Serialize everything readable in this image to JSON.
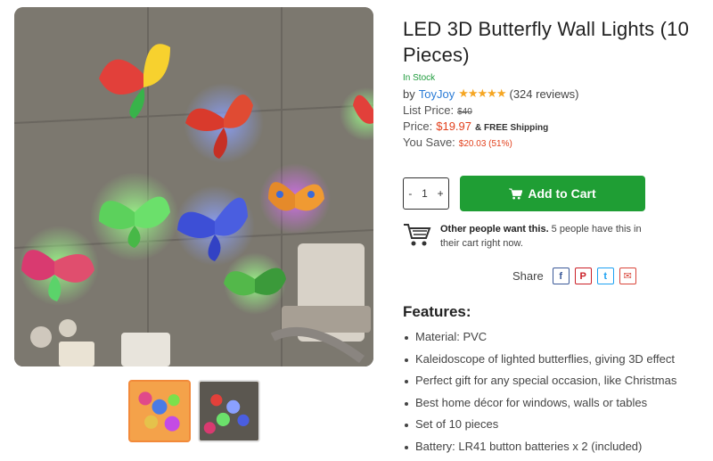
{
  "product": {
    "title": "LED 3D Butterfly Wall Lights (10 Pieces)",
    "stock": "In Stock",
    "by_label": "by",
    "brand": "ToyJoy",
    "rating": 4.5,
    "stars_text": "★★★★★",
    "reviews": "(324 reviews)",
    "list_price_label": "List Price:",
    "list_price": "$40",
    "price_label": "Price:",
    "price": "$19.97",
    "shipping": "& FREE Shipping",
    "save_label": "You Save:",
    "save_value": "$20.03 (51%)"
  },
  "cart": {
    "qty_minus": "-",
    "qty_value": "1",
    "qty_plus": "+",
    "add_label": "Add to Cart",
    "cart_icon": "cart-icon"
  },
  "social_proof": {
    "strong": "Other people want this.",
    "text": " 5 people have this in their cart right now.",
    "icon": "shopping-cart-icon"
  },
  "share": {
    "label": "Share",
    "facebook": "f",
    "pinterest": "P",
    "twitter": "t",
    "email": "✉"
  },
  "features": {
    "heading": "Features:",
    "items": [
      "Material: PVC",
      "Kaleidoscope of lighted butterflies, giving 3D effect",
      "Perfect gift for any special occasion, like Christmas",
      "Best home décor for windows, walls or tables",
      "Set of 10 pieces",
      "Battery: LR41 button batteries x 2 (included)"
    ]
  },
  "colors": {
    "accent_green": "#1f9e34",
    "price_red": "#e2401c",
    "brand_blue": "#2a7bd6",
    "stock_green": "#1e9b3c",
    "star": "#f5a623",
    "thumb_active": "#f28a3a"
  }
}
